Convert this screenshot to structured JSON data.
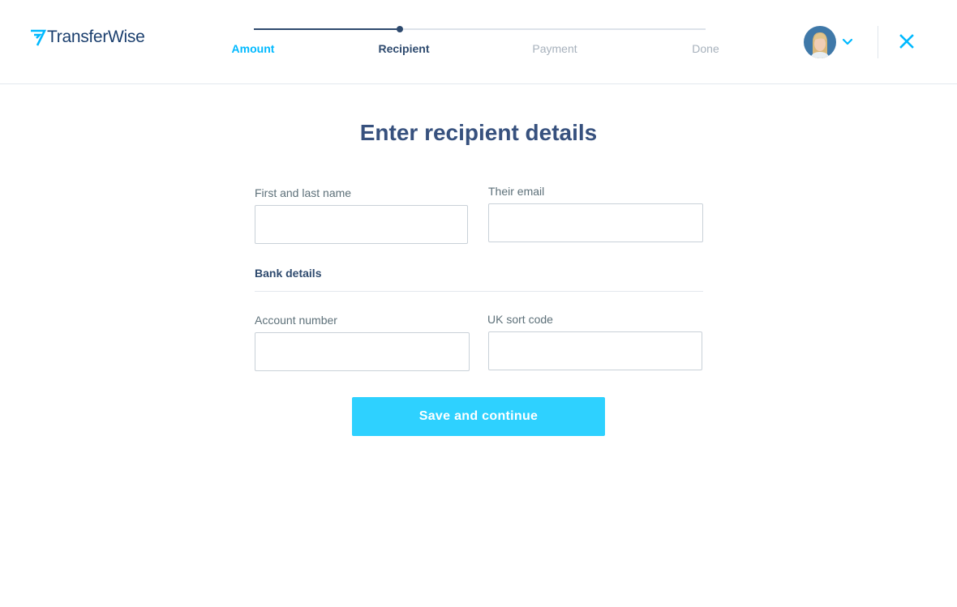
{
  "brand": {
    "name": "TransferWise"
  },
  "stepper": {
    "steps": [
      {
        "label": "Amount",
        "state": "completed"
      },
      {
        "label": "Recipient",
        "state": "current"
      },
      {
        "label": "Payment",
        "state": "upcoming"
      },
      {
        "label": "Done",
        "state": "upcoming"
      }
    ]
  },
  "header": {
    "avatar_icon": "user-avatar",
    "menu_icon": "chevron-down-icon",
    "close_icon": "close-icon"
  },
  "form": {
    "title": "Enter recipient details",
    "name_label": "First and last name",
    "name_value": "",
    "email_label": "Their email",
    "email_value": "",
    "bank_section_title": "Bank details",
    "account_label": "Account number",
    "account_value": "",
    "sortcode_label": "UK sort code",
    "sortcode_value": "",
    "submit_label": "Save and continue"
  },
  "colors": {
    "accent": "#00b9ff",
    "button": "#2ed1ff",
    "navy": "#37517e",
    "muted": "#a7b1bc"
  }
}
